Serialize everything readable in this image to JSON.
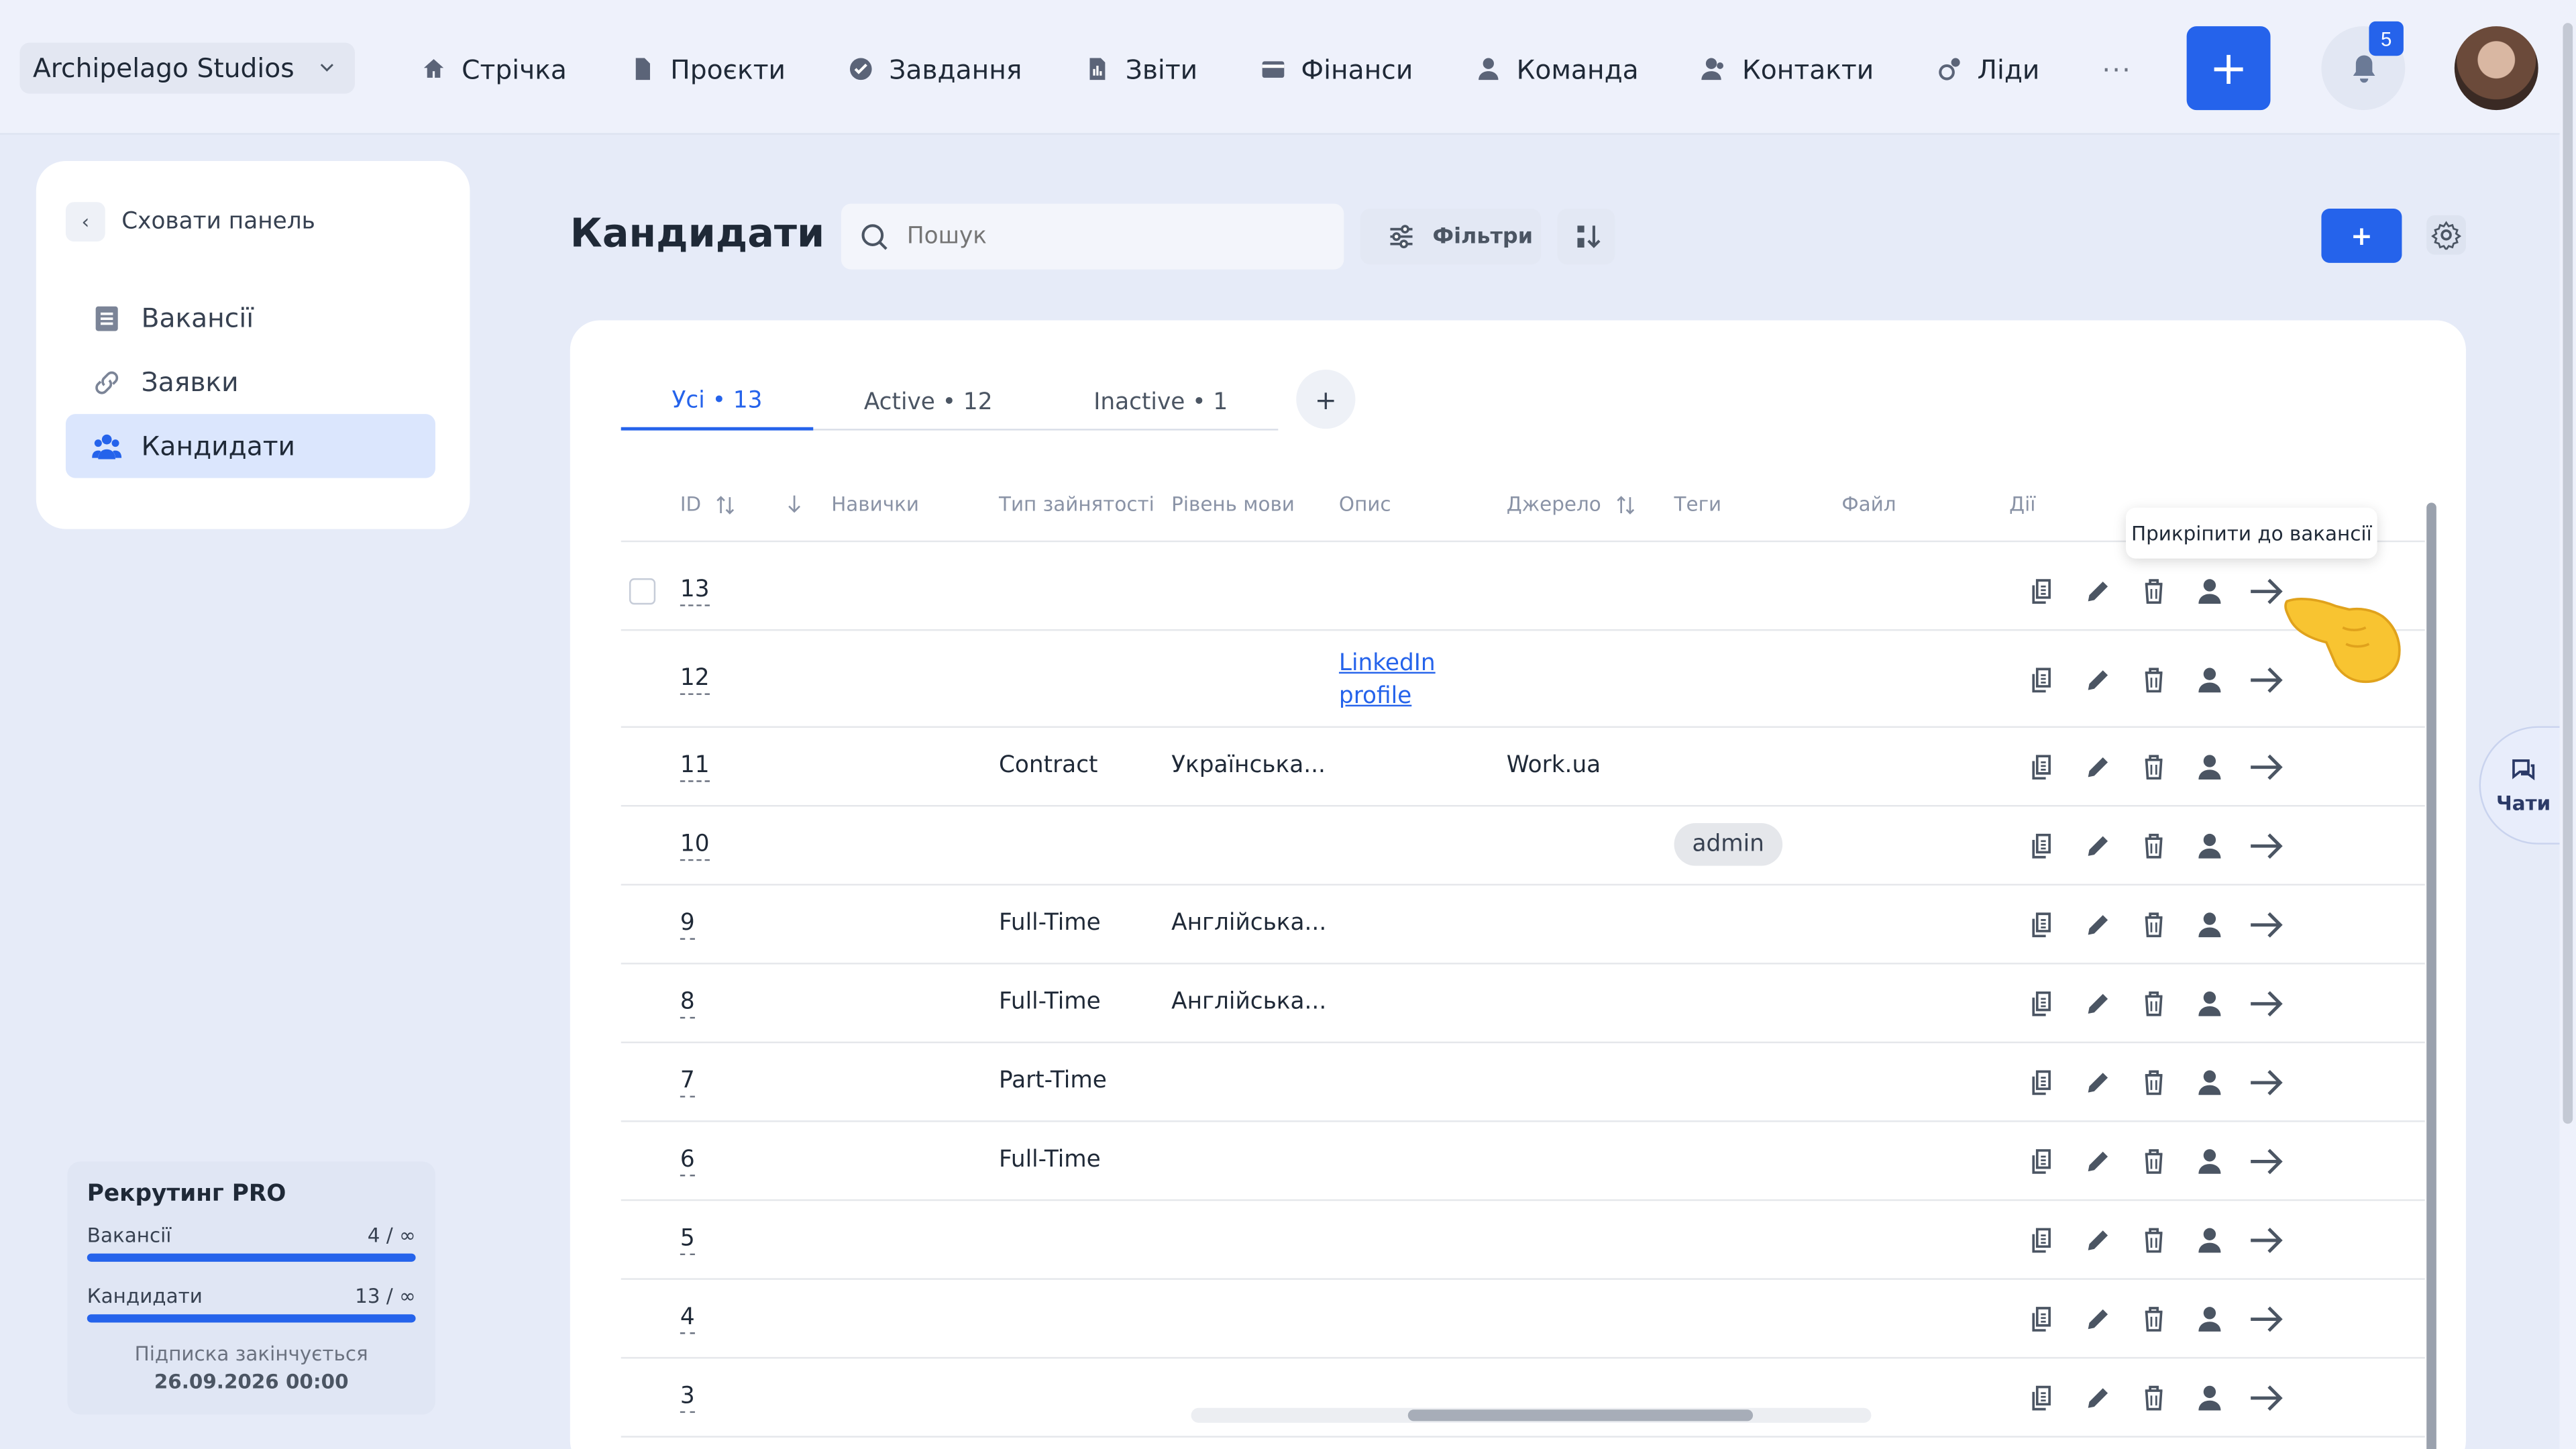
{
  "org": {
    "name": "Archipelago Studios"
  },
  "nav": [
    {
      "label": "Стрічка",
      "icon": "home-icon"
    },
    {
      "label": "Проєкти",
      "icon": "file-icon"
    },
    {
      "label": "Завдання",
      "icon": "check-circle-icon"
    },
    {
      "label": "Звіти",
      "icon": "report-icon"
    },
    {
      "label": "Фінанси",
      "icon": "wallet-icon"
    },
    {
      "label": "Команда",
      "icon": "user-icon"
    },
    {
      "label": "Контакти",
      "icon": "contacts-icon"
    },
    {
      "label": "Ліди",
      "icon": "leads-icon"
    }
  ],
  "nav_more": "···",
  "header": {
    "add_label": "+",
    "notification_count": "5"
  },
  "sidebar": {
    "hide_label": "Сховати панель",
    "items": [
      {
        "label": "Вакансії",
        "icon": "list-icon",
        "active": false
      },
      {
        "label": "Заявки",
        "icon": "link-icon",
        "active": false
      },
      {
        "label": "Кандидати",
        "icon": "people-icon",
        "active": true
      }
    ]
  },
  "plan": {
    "title": "Рекрутинг PRO",
    "rows": [
      {
        "label": "Вакансії",
        "value": "4 / ∞"
      },
      {
        "label": "Кандидати",
        "value": "13 / ∞"
      }
    ],
    "expires_label": "Підписка закінчується",
    "expires_date": "26.09.2026 00:00"
  },
  "page": {
    "title": "Кандидати",
    "search_placeholder": "Пошук",
    "filters_label": "Фільтри",
    "add_label": "+"
  },
  "tabs": [
    {
      "label": "Усі • 13",
      "active": true
    },
    {
      "label": "Active • 12",
      "active": false
    },
    {
      "label": "Inactive • 1",
      "active": false
    }
  ],
  "tab_add": "+",
  "columns": {
    "id": "ID",
    "skills": "Навички",
    "employment": "Тип зайнятості",
    "language": "Рівень мови",
    "description": "Опис",
    "source": "Джерело",
    "tags": "Теги",
    "file": "Файл",
    "actions": "Дії"
  },
  "rows": [
    {
      "id": "13",
      "employment": "",
      "language": "",
      "description": "",
      "source": "",
      "tag": ""
    },
    {
      "id": "12",
      "employment": "",
      "language": "",
      "description_link": [
        "LinkedIn",
        "profile"
      ],
      "source": "",
      "tag": ""
    },
    {
      "id": "11",
      "employment": "Contract",
      "language": "Українська...",
      "description": "",
      "source": "Work.ua",
      "tag": ""
    },
    {
      "id": "10",
      "employment": "",
      "language": "",
      "description": "",
      "source": "",
      "tag": "admin"
    },
    {
      "id": "9",
      "employment": "Full-Time",
      "language": "Англійська...",
      "description": "",
      "source": "",
      "tag": ""
    },
    {
      "id": "8",
      "employment": "Full-Time",
      "language": "Англійська...",
      "description": "",
      "source": "",
      "tag": ""
    },
    {
      "id": "7",
      "employment": "Part-Time",
      "language": "",
      "description": "",
      "source": "",
      "tag": ""
    },
    {
      "id": "6",
      "employment": "Full-Time",
      "language": "",
      "description": "",
      "source": "",
      "tag": ""
    },
    {
      "id": "5",
      "employment": "",
      "language": "",
      "description": "",
      "source": "",
      "tag": ""
    },
    {
      "id": "4",
      "employment": "",
      "language": "",
      "description": "",
      "source": "",
      "tag": ""
    },
    {
      "id": "3",
      "employment": "",
      "language": "",
      "description": "",
      "source": "",
      "tag": ""
    }
  ],
  "tooltip": "Прикріпити до вакансії",
  "chat": {
    "label": "Чати"
  },
  "colors": {
    "accent": "#2563eb",
    "background": "#e6ebf8"
  }
}
